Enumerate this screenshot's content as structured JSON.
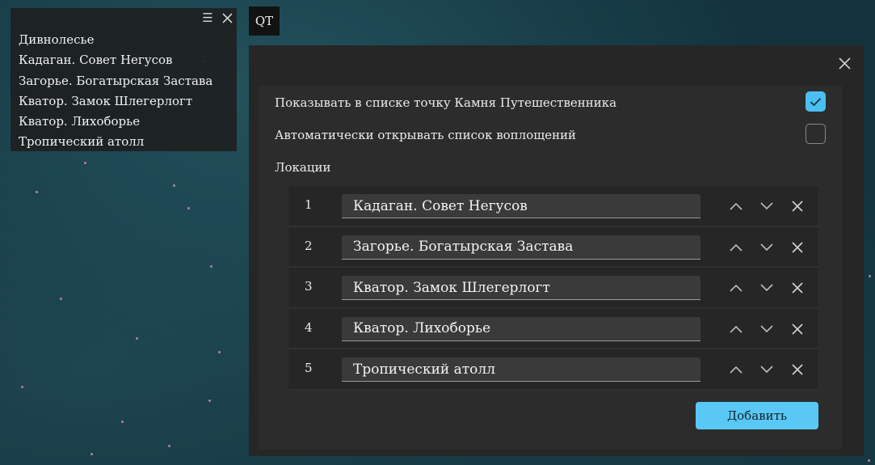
{
  "mini_window": {
    "items": [
      "Дивнолесье",
      "Кадаган. Совет Негусов",
      "Загорье. Богатырская Застава",
      "Кватор. Замок Шлегерлогт",
      "Кватор. Лихоборье",
      "Тропический атолл"
    ],
    "menu_icon": "hamburger-icon",
    "close_icon": "close-icon"
  },
  "qt_badge": "QT",
  "settings": {
    "options": [
      {
        "label": "Показывать в списке точку Камня Путешественника",
        "checked": true
      },
      {
        "label": "Автоматически открывать список воплощений",
        "checked": false
      }
    ],
    "section_title": "Локации",
    "locations": [
      {
        "num": "1",
        "name": "Кадаган. Совет Негусов"
      },
      {
        "num": "2",
        "name": "Загорье. Богатырская Застава"
      },
      {
        "num": "3",
        "name": "Кватор. Замок Шлегерлогт"
      },
      {
        "num": "4",
        "name": "Кватор. Лихоборье"
      },
      {
        "num": "5",
        "name": "Тропический атолл"
      }
    ],
    "add_label": "Добавить"
  },
  "colors": {
    "accent": "#5ac8f5",
    "checkbox_on": "#4bbef2",
    "star": "#d58ab0"
  }
}
